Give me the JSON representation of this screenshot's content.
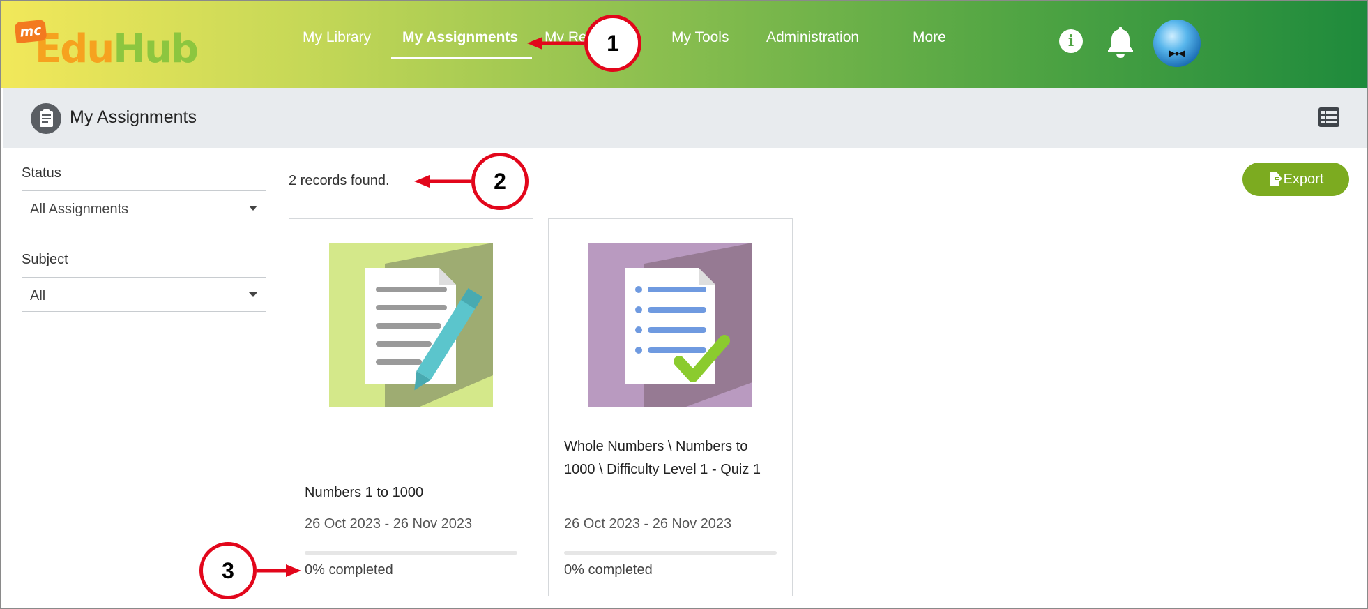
{
  "app": {
    "logo_badge": "mc",
    "logo_edu": "Edu",
    "logo_hub": "Hub"
  },
  "nav": {
    "items": [
      {
        "label": "My Library"
      },
      {
        "label": "My Assignments",
        "active": true
      },
      {
        "label": "My Re"
      },
      {
        "label": "My Tools"
      },
      {
        "label": "Administration"
      },
      {
        "label": "More"
      }
    ],
    "info_glyph": "i",
    "icons": [
      "info-icon",
      "bell-icon",
      "avatar"
    ]
  },
  "page": {
    "title": "My Assignments",
    "records_text": "2 records found.",
    "export_label": "Export"
  },
  "filters": {
    "status_label": "Status",
    "status_value": "All Assignments",
    "subject_label": "Subject",
    "subject_value": "All"
  },
  "assignments": [
    {
      "title": "Numbers 1 to 1000",
      "dates": "26 Oct 2023 - 26 Nov 2023",
      "completed_text": "0% completed",
      "progress": 0,
      "thumb_color": "#d4e88a"
    },
    {
      "title": "Whole Numbers \\ Numbers to 1000 \\ Difficulty Level 1 - Quiz 1",
      "dates": "26 Oct 2023 - 26 Nov 2023",
      "completed_text": "0% completed",
      "progress": 0,
      "thumb_color": "#b99ac0"
    }
  ],
  "callouts": [
    "1",
    "2",
    "3"
  ],
  "colors": {
    "accent_green": "#7cab20",
    "callout_red": "#e2061b"
  }
}
